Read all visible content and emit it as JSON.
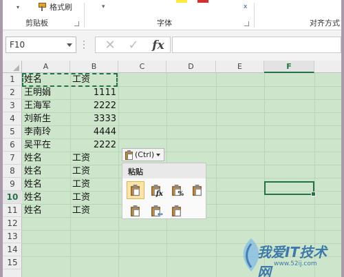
{
  "ribbon": {
    "format_painter_label": "格式刷",
    "groups": [
      {
        "label": "剪贴板"
      },
      {
        "label": "字体"
      },
      {
        "label": "对齐方式"
      }
    ],
    "font_color_accent": "#d32f2f",
    "highlight_accent": "#ffeb3b"
  },
  "formula_bar": {
    "name_box_value": "F10",
    "more_icon": "vertical-dots-icon",
    "cancel_icon": "cross-icon",
    "enter_icon": "check-icon",
    "function_label": "fx",
    "formula_value": ""
  },
  "sheet": {
    "columns": [
      "A",
      "B",
      "C",
      "D",
      "E",
      "F"
    ],
    "selected_column": "F",
    "rows": [
      "1",
      "2",
      "3",
      "4",
      "5",
      "6",
      "7",
      "8",
      "9",
      "10",
      "11",
      "12",
      "13",
      "14",
      "15"
    ],
    "selected_row": "10",
    "grid_color": "#cde5cb",
    "accent": "#217346",
    "cells": {
      "A1": "姓名",
      "B1": "工资",
      "A2": "王明娟",
      "B2": "1111",
      "A3": "王海军",
      "B3": "2222",
      "A4": "刘新生",
      "B4": "3333",
      "A5": "李南玲",
      "B5": "4444",
      "A6": "吴平在",
      "B6": "2222",
      "A7": "姓名",
      "B7": "工资",
      "A8": "姓名",
      "B8": "工资",
      "A9": "姓名",
      "B9": "工资",
      "A10": "姓名",
      "B10": "工资",
      "A11": "姓名",
      "B11": "工资"
    },
    "active_cell": "F10",
    "copy_range": "A1:B1"
  },
  "paste_options": {
    "button_label": "(Ctrl)",
    "menu_title": "粘贴",
    "icons": [
      "paste-icon",
      "paste-formulas-icon",
      "paste-formulas-number-format-icon",
      "paste-keep-source-format-icon",
      "paste-no-borders-icon",
      "paste-keep-column-widths-icon",
      "paste-transpose-icon"
    ]
  },
  "watermark": {
    "text": "我爱IT技术网",
    "url": "www.52ij.com"
  }
}
